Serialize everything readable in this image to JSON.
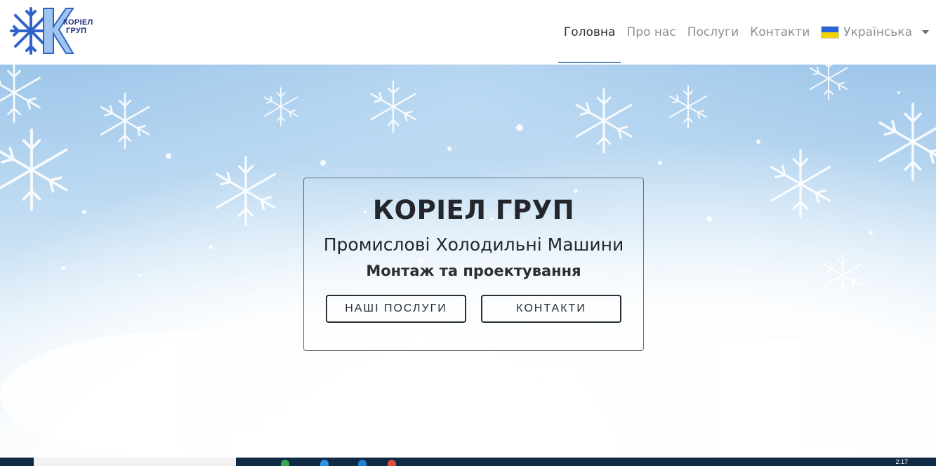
{
  "logo": {
    "line1": "КОРІЕЛ",
    "line2": "ГРУП",
    "icon": "snowflake-k-logo"
  },
  "nav": {
    "items": [
      {
        "label": "Головна",
        "active": true
      },
      {
        "label": "Про нас",
        "active": false
      },
      {
        "label": "Послуги",
        "active": false
      },
      {
        "label": "Контакти",
        "active": false
      }
    ],
    "language": {
      "label": "Українська",
      "icon": "ukraine-flag-icon"
    }
  },
  "hero": {
    "title": "КОРІЕЛ ГРУП",
    "subtitle": "Промислові Холодильні Машини",
    "tagline": "Монтаж та проектування",
    "buttons": {
      "services": "НАШІ ПОСЛУГИ",
      "contacts": "КОНТАКТИ"
    }
  },
  "taskbar": {
    "time": "2:17"
  },
  "colors": {
    "accent": "#5b86c9",
    "text_dark": "#23262a",
    "nav_muted": "#8a8f96",
    "taskbar": "#0e2a45"
  }
}
